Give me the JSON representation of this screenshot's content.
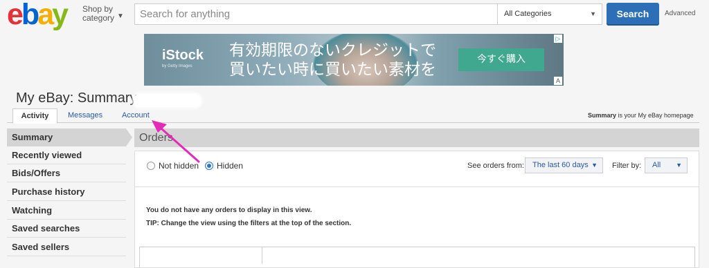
{
  "header": {
    "logo_letters": [
      {
        "ch": "e",
        "color": "#e53238"
      },
      {
        "ch": "b",
        "color": "#0064d2"
      },
      {
        "ch": "a",
        "color": "#f5af02"
      },
      {
        "ch": "y",
        "color": "#86b817"
      }
    ],
    "shop_by_line1": "Shop by",
    "shop_by_line2": "category",
    "search_placeholder": "Search for anything",
    "category_value": "All Categories",
    "search_button": "Search",
    "advanced_link": "Advanced"
  },
  "ad": {
    "brand": "iStock",
    "brand_sub": "by Getty Images",
    "copy_line1": "有効期限のないクレジットで",
    "copy_line2": "買いたい時に買いたい素材を",
    "button": "今すぐ購入"
  },
  "page": {
    "title": "My eBay: Summary",
    "tabs": [
      "Activity",
      "Messages",
      "Account"
    ],
    "summary_note_bold": "Summary",
    "summary_note_rest": " is your My eBay homepage"
  },
  "sidebar": {
    "items": [
      "Summary",
      "Recently viewed",
      "Bids/Offers",
      "Purchase history",
      "Watching",
      "Saved searches",
      "Saved sellers"
    ]
  },
  "orders": {
    "heading": "Orders",
    "radio_not_hidden": "Not hidden",
    "radio_hidden": "Hidden",
    "see_orders_label": "See orders from:",
    "period_value": "The last 60 days",
    "filter_label": "Filter by:",
    "filter_value": "All",
    "empty_message": "You do not have any orders to display in this view.",
    "tip_message": "TIP: Change the view using the filters at the top of the section."
  },
  "colors": {
    "accent_blue": "#2d6fb6",
    "link_blue": "#2a59a6",
    "annotation_arrow": "#e52ab8"
  }
}
